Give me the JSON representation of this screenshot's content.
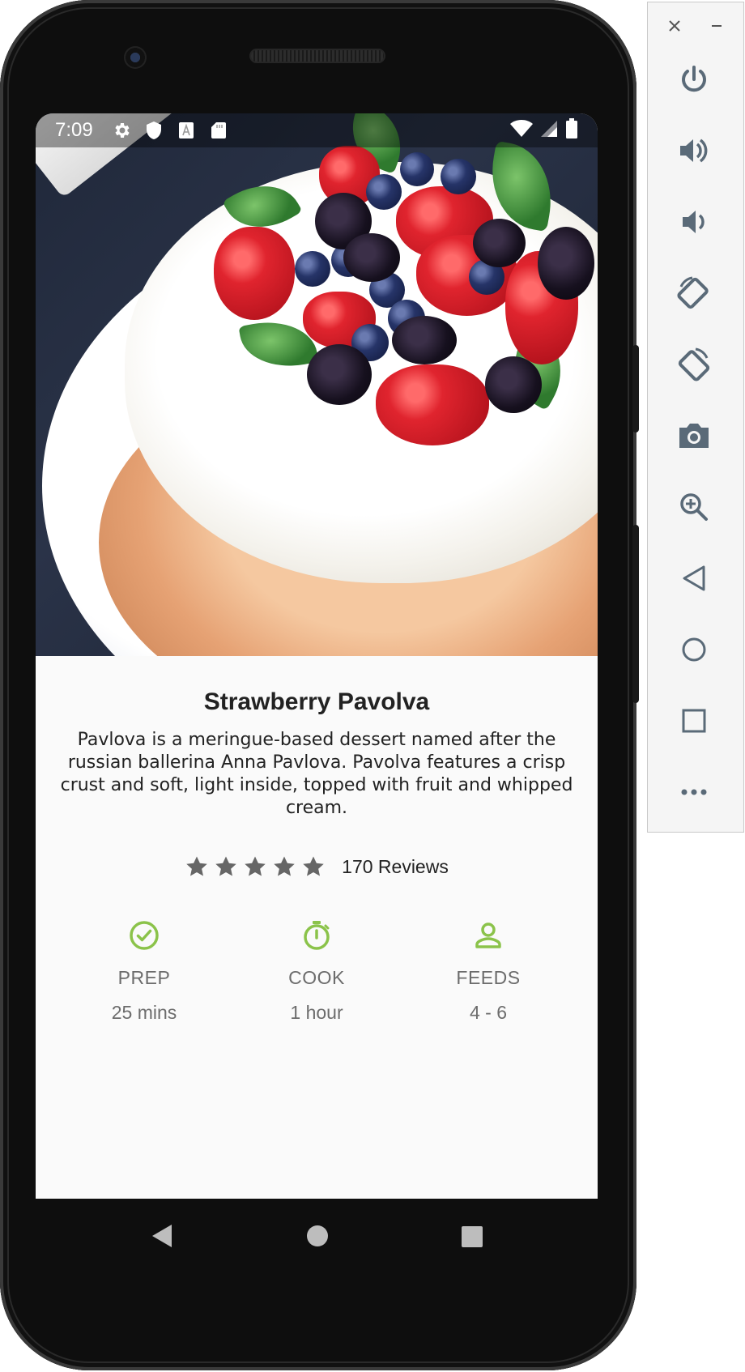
{
  "status_bar": {
    "time": "7:09",
    "left_icons": [
      "settings-icon",
      "shield-icon",
      "a-badge-icon",
      "sd-card-icon"
    ],
    "right_icons": [
      "wifi-icon",
      "signal-icon",
      "battery-icon"
    ]
  },
  "recipe": {
    "title": "Strawberry Pavolva",
    "description": "Pavlova is a meringue-based dessert named after the russian ballerina Anna Pavlova.  Pavolva features a crisp crust and soft, light inside, topped with fruit and whipped cream.",
    "rating": {
      "stars": 5,
      "max": 5,
      "reviews": "170 Reviews"
    },
    "stats": [
      {
        "icon": "check-circle-icon",
        "label": "PREP",
        "value": "25 mins"
      },
      {
        "icon": "stopwatch-icon",
        "label": "COOK",
        "value": "1 hour"
      },
      {
        "icon": "person-icon",
        "label": "FEEDS",
        "value": "4 - 6"
      }
    ]
  },
  "colors": {
    "accent_green": "#8bc34a",
    "star_gray": "#666666",
    "stat_text": "#6c6c6c",
    "screen_bg": "#fafafa"
  },
  "emulator_panel": {
    "controls": [
      "close-icon",
      "minimize-icon",
      "power-icon",
      "volume-up-icon",
      "volume-down-icon",
      "rotate-left-icon",
      "rotate-right-icon",
      "camera-icon",
      "zoom-icon",
      "back-icon",
      "home-icon",
      "overview-icon",
      "more-icon"
    ]
  }
}
